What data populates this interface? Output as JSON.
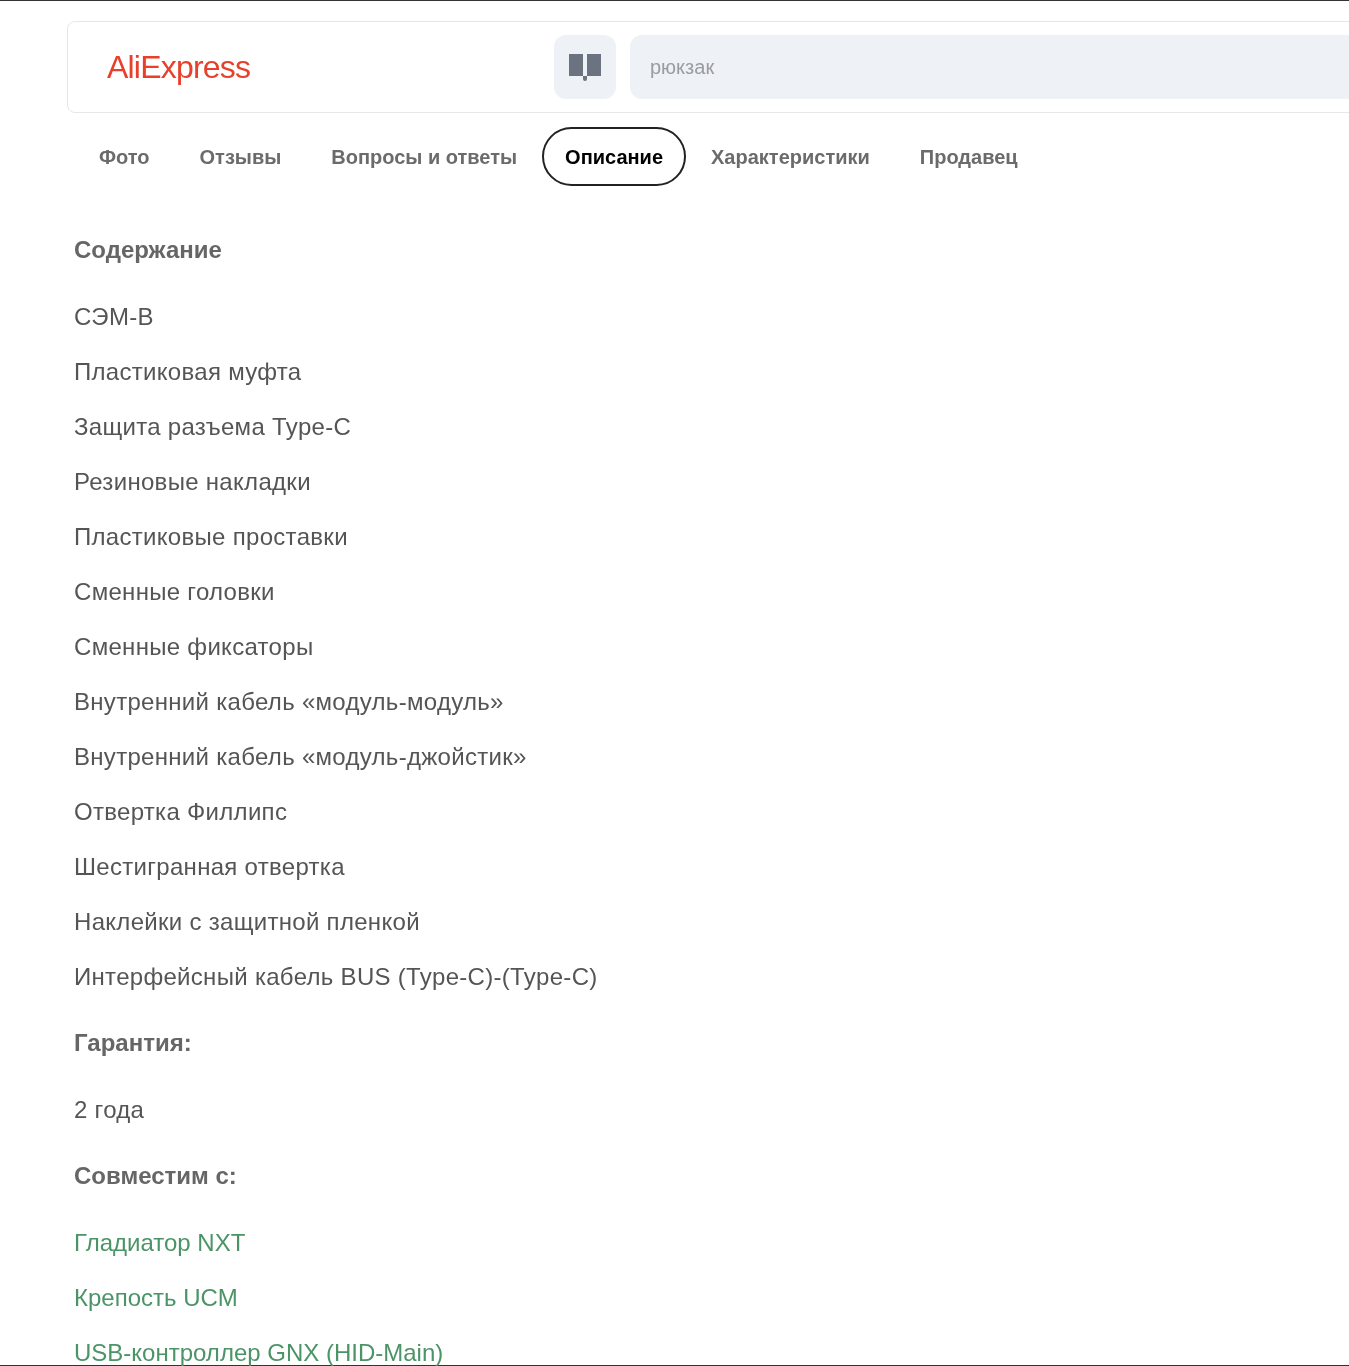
{
  "header": {
    "logo": "AliExpress",
    "search": {
      "placeholder": "рюкзак"
    }
  },
  "tabs": [
    {
      "label": "Фото",
      "selected": false
    },
    {
      "label": "Отзывы",
      "selected": false
    },
    {
      "label": "Вопросы и ответы",
      "selected": false
    },
    {
      "label": "Описание",
      "selected": true
    },
    {
      "label": "Характеристики",
      "selected": false
    },
    {
      "label": "Продавец",
      "selected": false
    }
  ],
  "description": {
    "sections": [
      {
        "heading": "Содержание",
        "items": [
          {
            "kind": "text",
            "text": "СЭМ-В"
          },
          {
            "kind": "text",
            "text": "Пластиковая муфта"
          },
          {
            "kind": "text",
            "text": "Защита разъема Type-C"
          },
          {
            "kind": "text",
            "text": "Резиновые накладки"
          },
          {
            "kind": "text",
            "text": "Пластиковые проставки"
          },
          {
            "kind": "text",
            "text": "Сменные головки"
          },
          {
            "kind": "text",
            "text": "Сменные фиксаторы"
          },
          {
            "kind": "text",
            "text": "Внутренний кабель «модуль-модуль»"
          },
          {
            "kind": "text",
            "text": "Внутренний кабель «модуль-джойстик»"
          },
          {
            "kind": "text",
            "text": "Отвертка Филлипс"
          },
          {
            "kind": "text",
            "text": "Шестигранная отвертка"
          },
          {
            "kind": "text",
            "text": "Наклейки с защитной пленкой"
          },
          {
            "kind": "text",
            "text": "Интерфейсный кабель BUS (Type-C)-(Type-C)"
          }
        ]
      },
      {
        "heading": "Гарантия:",
        "items": [
          {
            "kind": "text",
            "text": "2 года"
          }
        ]
      },
      {
        "heading": "Совместим с:",
        "items": [
          {
            "kind": "link",
            "text": "Гладиатор NXT"
          },
          {
            "kind": "link",
            "text": "Крепость UCM"
          },
          {
            "kind": "link",
            "text": "USB-контроллер GNX (HID-Main)"
          }
        ]
      }
    ]
  }
}
